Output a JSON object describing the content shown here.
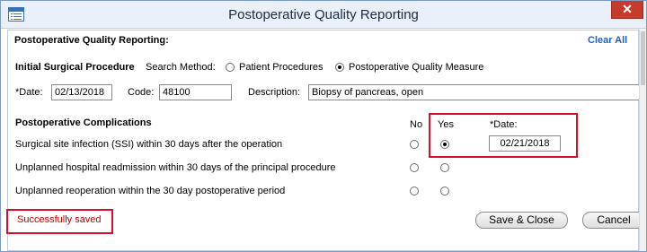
{
  "window": {
    "title": "Postoperative Quality Reporting",
    "close_label": "✕"
  },
  "form": {
    "heading": "Postoperative Quality Reporting:",
    "clear_all": "Clear All",
    "initial": {
      "section_label": "Initial Surgical Procedure",
      "search_method_label": "Search Method:",
      "option_patient": "Patient Procedures",
      "option_measure": "Postoperative Quality Measure",
      "selected": "Postoperative Quality Measure",
      "date_label": "*Date:",
      "date_value": "02/13/2018",
      "code_label": "Code:",
      "code_value": "48100",
      "description_label": "Description:",
      "description_value": "Biopsy of pancreas, open"
    },
    "complications": {
      "section_label": "Postoperative Complications",
      "col_no": "No",
      "col_yes": "Yes",
      "col_date": "*Date:",
      "rows": [
        {
          "label": "Surgical site infection (SSI) within 30 days after the operation",
          "selected": "yes",
          "date": "02/21/2018"
        },
        {
          "label": "Unplanned hospital readmission within 30 days of the principal procedure",
          "selected": "none",
          "date": ""
        },
        {
          "label": "Unplanned reoperation within the 30 day postoperative period",
          "selected": "none",
          "date": ""
        }
      ]
    },
    "status": "Successfully saved",
    "buttons": {
      "save_close": "Save & Close",
      "cancel": "Cancel"
    }
  },
  "colors": {
    "highlight": "#d4102a",
    "status_text": "#c00000",
    "link": "#1f5fbf",
    "close_button": "#c83a2c"
  }
}
